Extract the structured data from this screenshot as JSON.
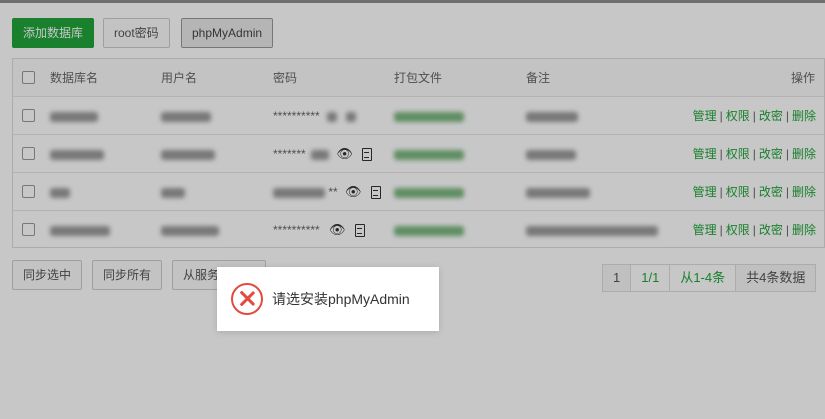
{
  "toolbar": {
    "add_db": "添加数据库",
    "root_password": "root密码",
    "phpmyadmin": "phpMyAdmin"
  },
  "table": {
    "columns": {
      "name": "数据库名",
      "user": "用户名",
      "password": "密码",
      "backup": "打包文件",
      "note": "备注",
      "actions": "操作"
    },
    "rows": [
      {
        "password": "**********",
        "ops": [
          "管理",
          "权限",
          "改密",
          "删除"
        ]
      },
      {
        "password": "*******",
        "ops": [
          "管理",
          "权限",
          "改密",
          "删除"
        ]
      },
      {
        "password": "**",
        "ops": [
          "管理",
          "权限",
          "改密",
          "删除"
        ]
      },
      {
        "password": "**********",
        "ops": [
          "管理",
          "权限",
          "改密",
          "删除"
        ]
      }
    ]
  },
  "footer": {
    "sync_selected": "同步选中",
    "sync_all": "同步所有",
    "from_server": "从服务"
  },
  "pagination": {
    "page": "1",
    "pages": "1/1",
    "range": "从1-4条",
    "total": "共4条数据"
  },
  "toast": {
    "message": "请选安装phpMyAdmin",
    "icon": "error-x-circle-icon",
    "color": "#e54a3f"
  },
  "colors": {
    "accent": "#20a53a"
  }
}
